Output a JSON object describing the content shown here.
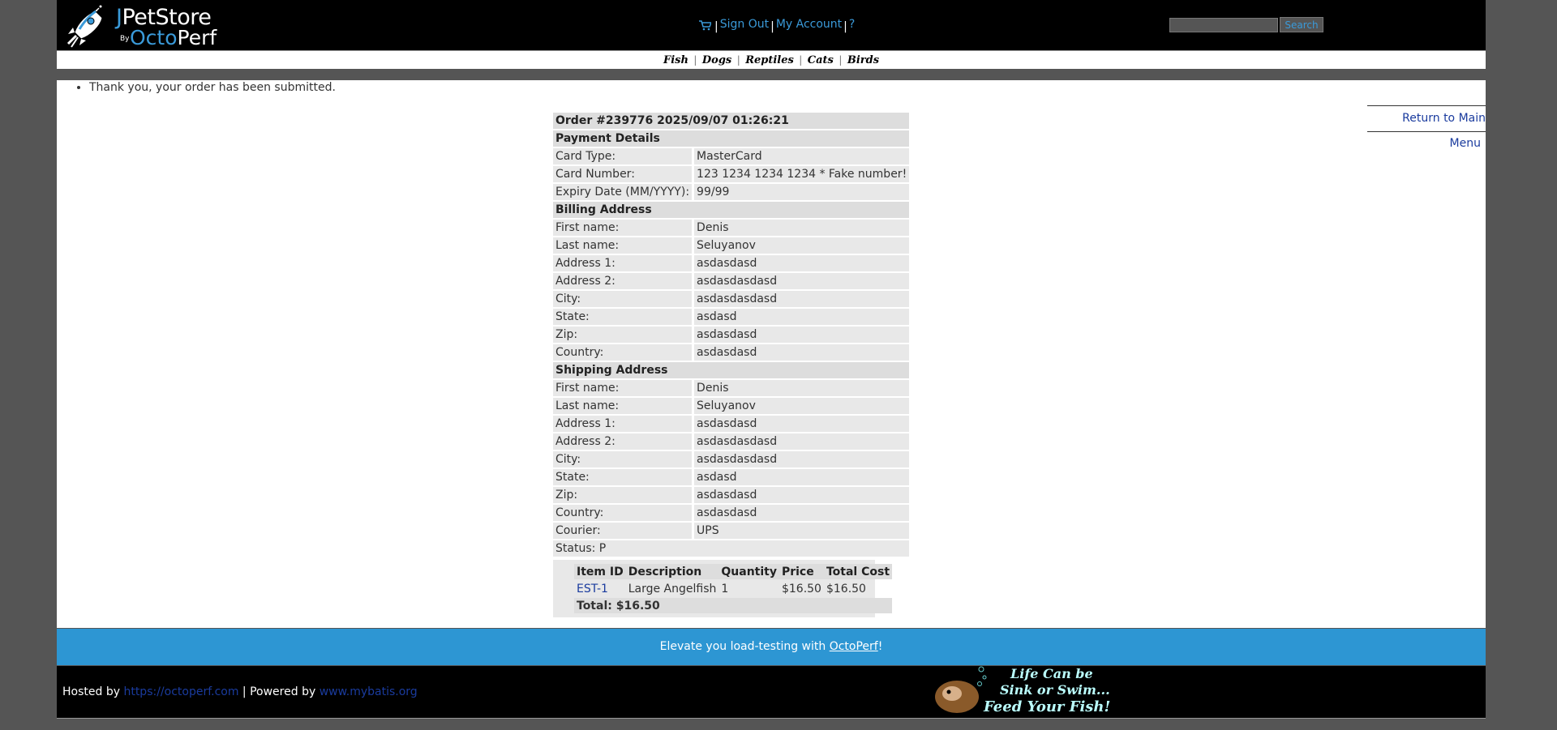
{
  "header": {
    "brand_top": "JPetStore",
    "brand_by": "By",
    "brand_bottom": "OctoPerf",
    "menu": {
      "sign_out": "Sign Out",
      "my_account": "My Account",
      "help": "?"
    },
    "search": {
      "value": "",
      "button": "Search"
    }
  },
  "quicklinks": [
    "Fish",
    "Dogs",
    "Reptiles",
    "Cats",
    "Birds"
  ],
  "messages": [
    "Thank you, your order has been submitted."
  ],
  "return_link": "Return to Main Menu",
  "order": {
    "title": "Order #239776 2025/09/07 01:26:21",
    "payment": {
      "heading": "Payment Details",
      "rows": [
        {
          "label": "Card Type:",
          "value": "MasterCard"
        },
        {
          "label": "Card Number:",
          "value": "123 1234 1234 1234 * Fake number!"
        },
        {
          "label": "Expiry Date (MM/YYYY):",
          "value": "99/99"
        }
      ]
    },
    "billing": {
      "heading": "Billing Address",
      "rows": [
        {
          "label": "First name:",
          "value": "Denis"
        },
        {
          "label": "Last name:",
          "value": "Seluyanov"
        },
        {
          "label": "Address 1:",
          "value": "asdasdasd"
        },
        {
          "label": "Address 2:",
          "value": "asdasdasdasd"
        },
        {
          "label": "City:",
          "value": "asdasdasdasd"
        },
        {
          "label": "State:",
          "value": "asdasd"
        },
        {
          "label": "Zip:",
          "value": "asdasdasd"
        },
        {
          "label": "Country:",
          "value": "asdasdasd"
        }
      ]
    },
    "shipping": {
      "heading": "Shipping Address",
      "rows": [
        {
          "label": "First name:",
          "value": "Denis"
        },
        {
          "label": "Last name:",
          "value": "Seluyanov"
        },
        {
          "label": "Address 1:",
          "value": "asdasdasd"
        },
        {
          "label": "Address 2:",
          "value": "asdasdasdasd"
        },
        {
          "label": "City:",
          "value": "asdasdasdasd"
        },
        {
          "label": "State:",
          "value": "asdasd"
        },
        {
          "label": "Zip:",
          "value": "asdasdasd"
        },
        {
          "label": "Country:",
          "value": "asdasdasd"
        },
        {
          "label": "Courier:",
          "value": "UPS"
        }
      ]
    },
    "status": "Status: P",
    "items": {
      "headers": [
        "Item ID",
        "Description",
        "Quantity",
        "Price",
        "Total Cost"
      ],
      "rows": [
        {
          "item_id": "EST-1",
          "description": "Large Angelfish",
          "quantity": "1",
          "price": "$16.50",
          "total": "$16.50"
        }
      ],
      "total": "Total: $16.50"
    }
  },
  "footer": {
    "promo_prefix": "Elevate you load-testing with ",
    "promo_link": "OctoPerf",
    "promo_suffix": "!",
    "hosted_prefix": "Hosted by ",
    "hosted_link": "https://octoperf.com",
    "powered_prefix": " | Powered by ",
    "powered_link": "www.mybatis.org",
    "banner_line1": "Life Can be",
    "banner_line2": "Sink or Swim...",
    "banner_line3": "Feed Your Fish!"
  },
  "colors": {
    "accent": "#2d96d3",
    "link": "#1a3b9e",
    "header_bg": "#000000"
  }
}
